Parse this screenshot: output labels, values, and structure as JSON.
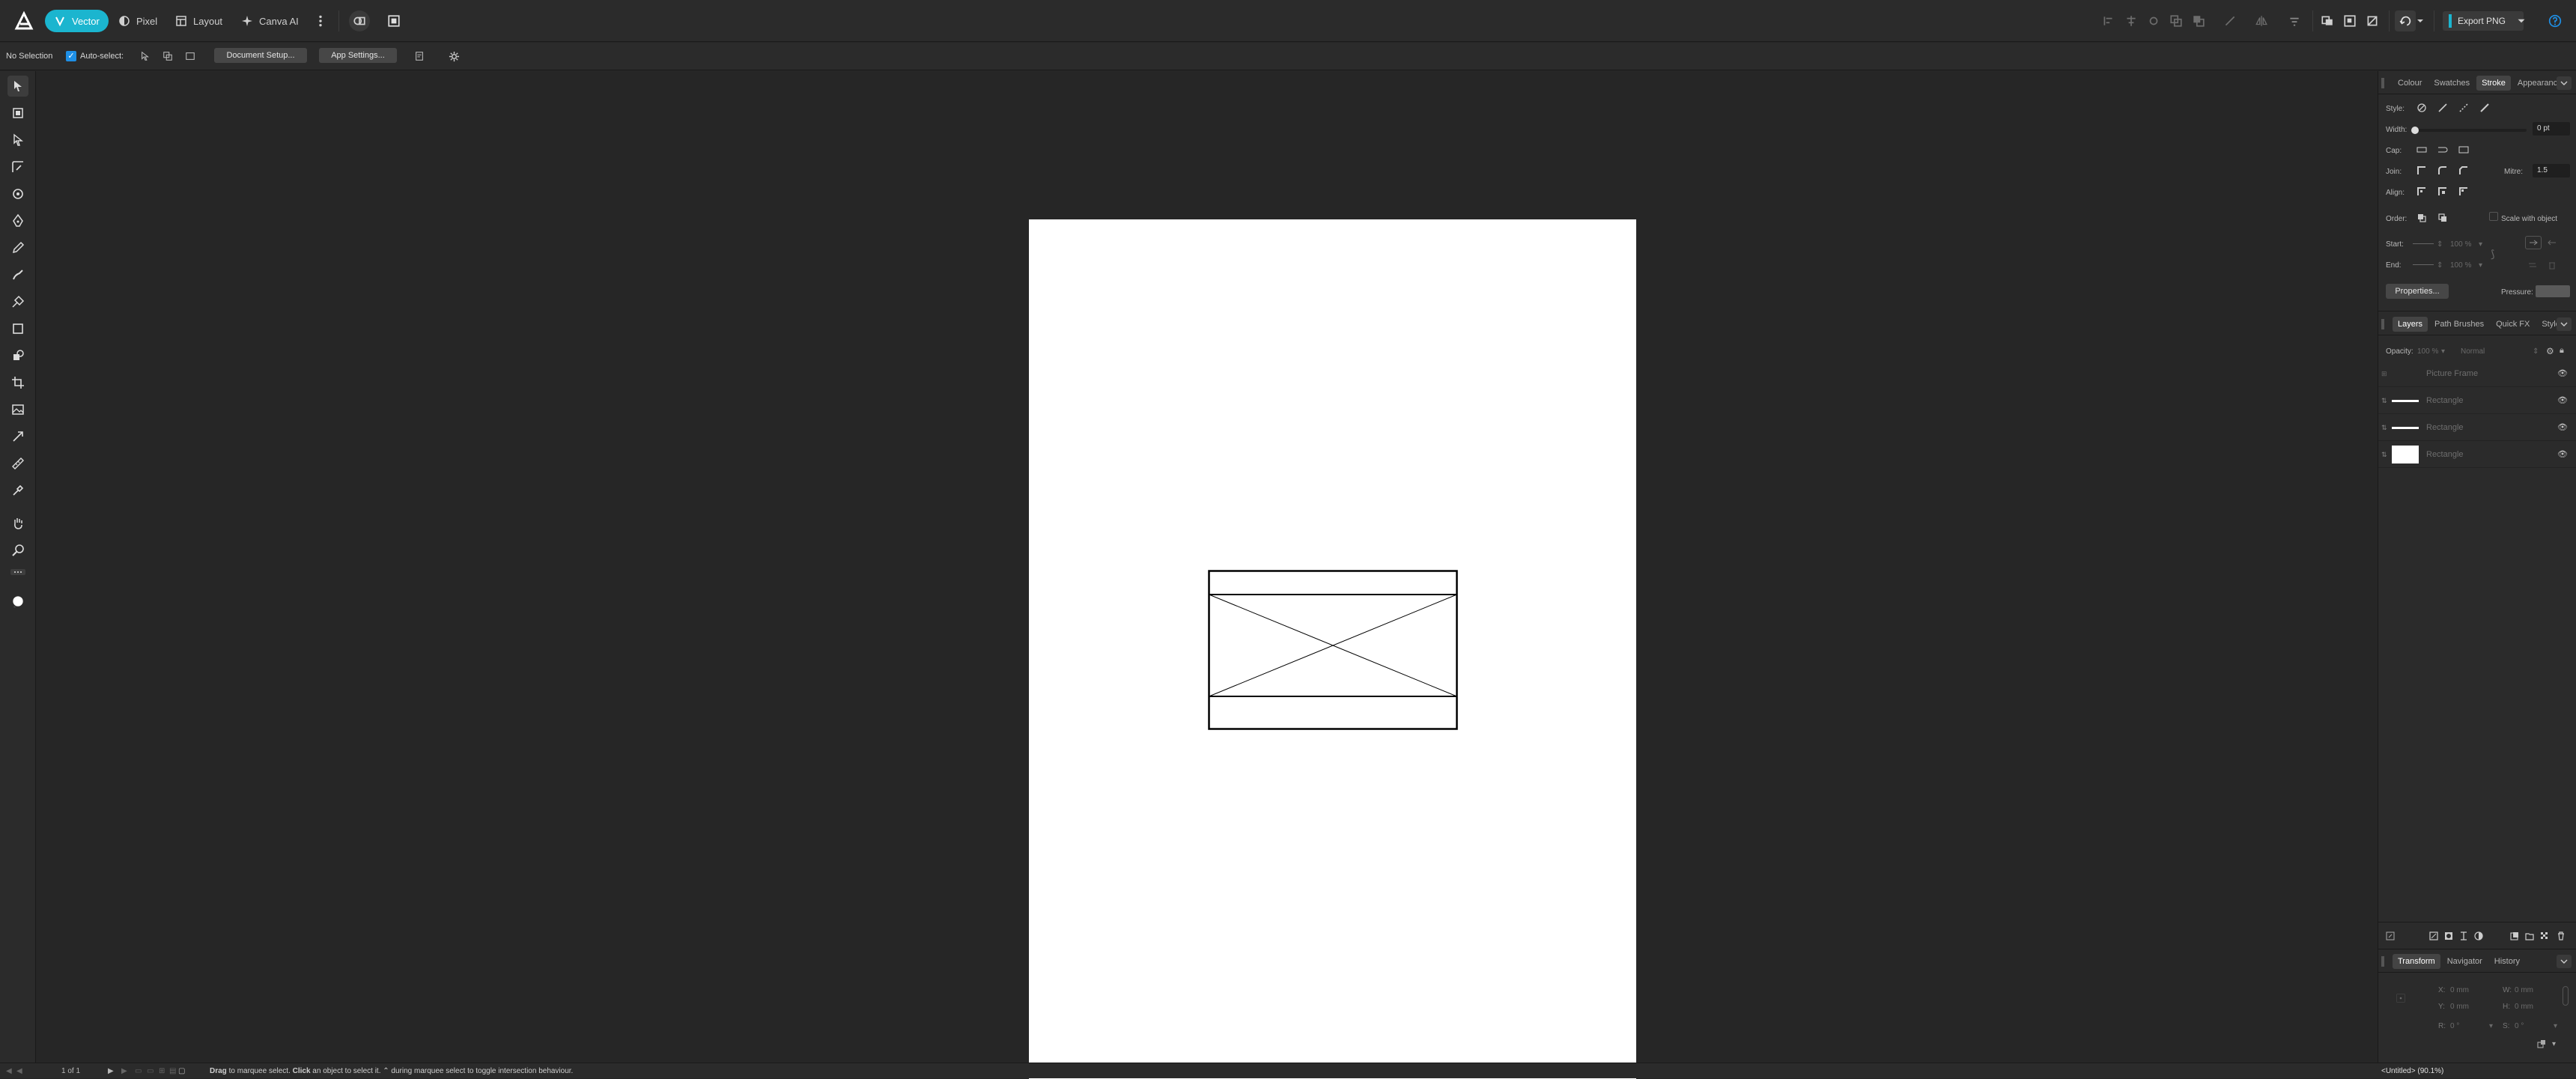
{
  "top_bar": {
    "personas": [
      {
        "label": "Vector",
        "icon": "vector-persona-icon",
        "active": true
      },
      {
        "label": "Pixel",
        "icon": "pixel-persona-icon",
        "active": false
      },
      {
        "label": "Layout",
        "icon": "layout-persona-icon",
        "active": false
      },
      {
        "label": "Canva AI",
        "icon": "sparkle-icon",
        "active": false
      }
    ],
    "export_label": "Export PNG"
  },
  "context_bar": {
    "selection_status": "No Selection",
    "auto_select_label": "Auto-select:",
    "document_setup_label": "Document Setup...",
    "app_settings_label": "App Settings..."
  },
  "stroke_panel": {
    "tabs": [
      "Colour",
      "Swatches",
      "Stroke",
      "Appearance"
    ],
    "active_tab": "Stroke",
    "style_label": "Style:",
    "width_label": "Width:",
    "width_value": "0 pt",
    "cap_label": "Cap:",
    "join_label": "Join:",
    "mitre_label": "Mitre:",
    "mitre_value": "1.5",
    "align_label": "Align:",
    "order_label": "Order:",
    "scale_with_object_label": "Scale with object",
    "start_label": "Start:",
    "end_label": "End:",
    "start_percent": "100 %",
    "end_percent": "100 %",
    "properties_label": "Properties...",
    "pressure_label": "Pressure:"
  },
  "layers_panel": {
    "tabs": [
      "Layers",
      "Path Brushes",
      "Quick FX",
      "Styles"
    ],
    "active_tab": "Layers",
    "opacity_label": "Opacity:",
    "opacity_value": "100 %",
    "blend_mode": "Normal",
    "layers": [
      {
        "name": "Picture Frame",
        "thumb": "frame"
      },
      {
        "name": "Rectangle",
        "thumb": "line"
      },
      {
        "name": "Rectangle",
        "thumb": "line"
      },
      {
        "name": "Rectangle",
        "thumb": "white"
      }
    ]
  },
  "transform_panel": {
    "tabs": [
      "Transform",
      "Navigator",
      "History"
    ],
    "active_tab": "Transform",
    "x_label": "X:",
    "x_value": "0 mm",
    "y_label": "Y:",
    "y_value": "0 mm",
    "w_label": "W:",
    "w_value": "0 mm",
    "h_label": "H:",
    "h_value": "0 mm",
    "r_label": "R:",
    "r_value": "0 °",
    "s_label": "S:",
    "s_value": "0 °"
  },
  "status_bar": {
    "page_indicator": "1 of 1",
    "hint_drag": "Drag",
    "hint_1": " to marquee select. ",
    "hint_click": "Click",
    "hint_2": " an object to select it. ",
    "hint_3": "⌃ during marquee select to toggle intersection behaviour.",
    "document_info": "<Untitled> (90.1%)"
  },
  "colors": {
    "accent": "#1bb5cf",
    "panel_bg": "#2b2b2b",
    "canvas_bg": "#262626",
    "page": "#ffffff"
  }
}
